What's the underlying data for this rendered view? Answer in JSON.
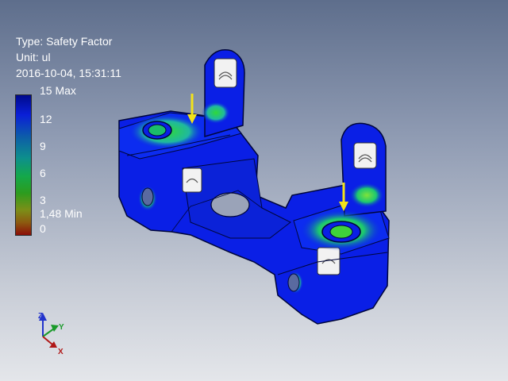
{
  "result": {
    "type_label": "Type: Safety Factor",
    "unit_label": "Unit: ul",
    "timestamp": "2016-10-04, 15:31:11"
  },
  "scale": {
    "max_label": "15 Max",
    "tick_12": "12",
    "tick_9": "9",
    "tick_6": "6",
    "tick_3": "3",
    "min_label": "1,48 Min",
    "tick_0": "0",
    "colors": [
      "#000a8c",
      "#0a1fd8",
      "#0d8f8c",
      "#14a84a",
      "#7b8f18",
      "#8c0e08"
    ]
  },
  "view_triad": {
    "z_label": "Z",
    "y_label": "Y",
    "x_label": "X"
  },
  "model": {
    "base_color": "#0a1fe6",
    "load_arrow_color": "#f2e21a"
  }
}
